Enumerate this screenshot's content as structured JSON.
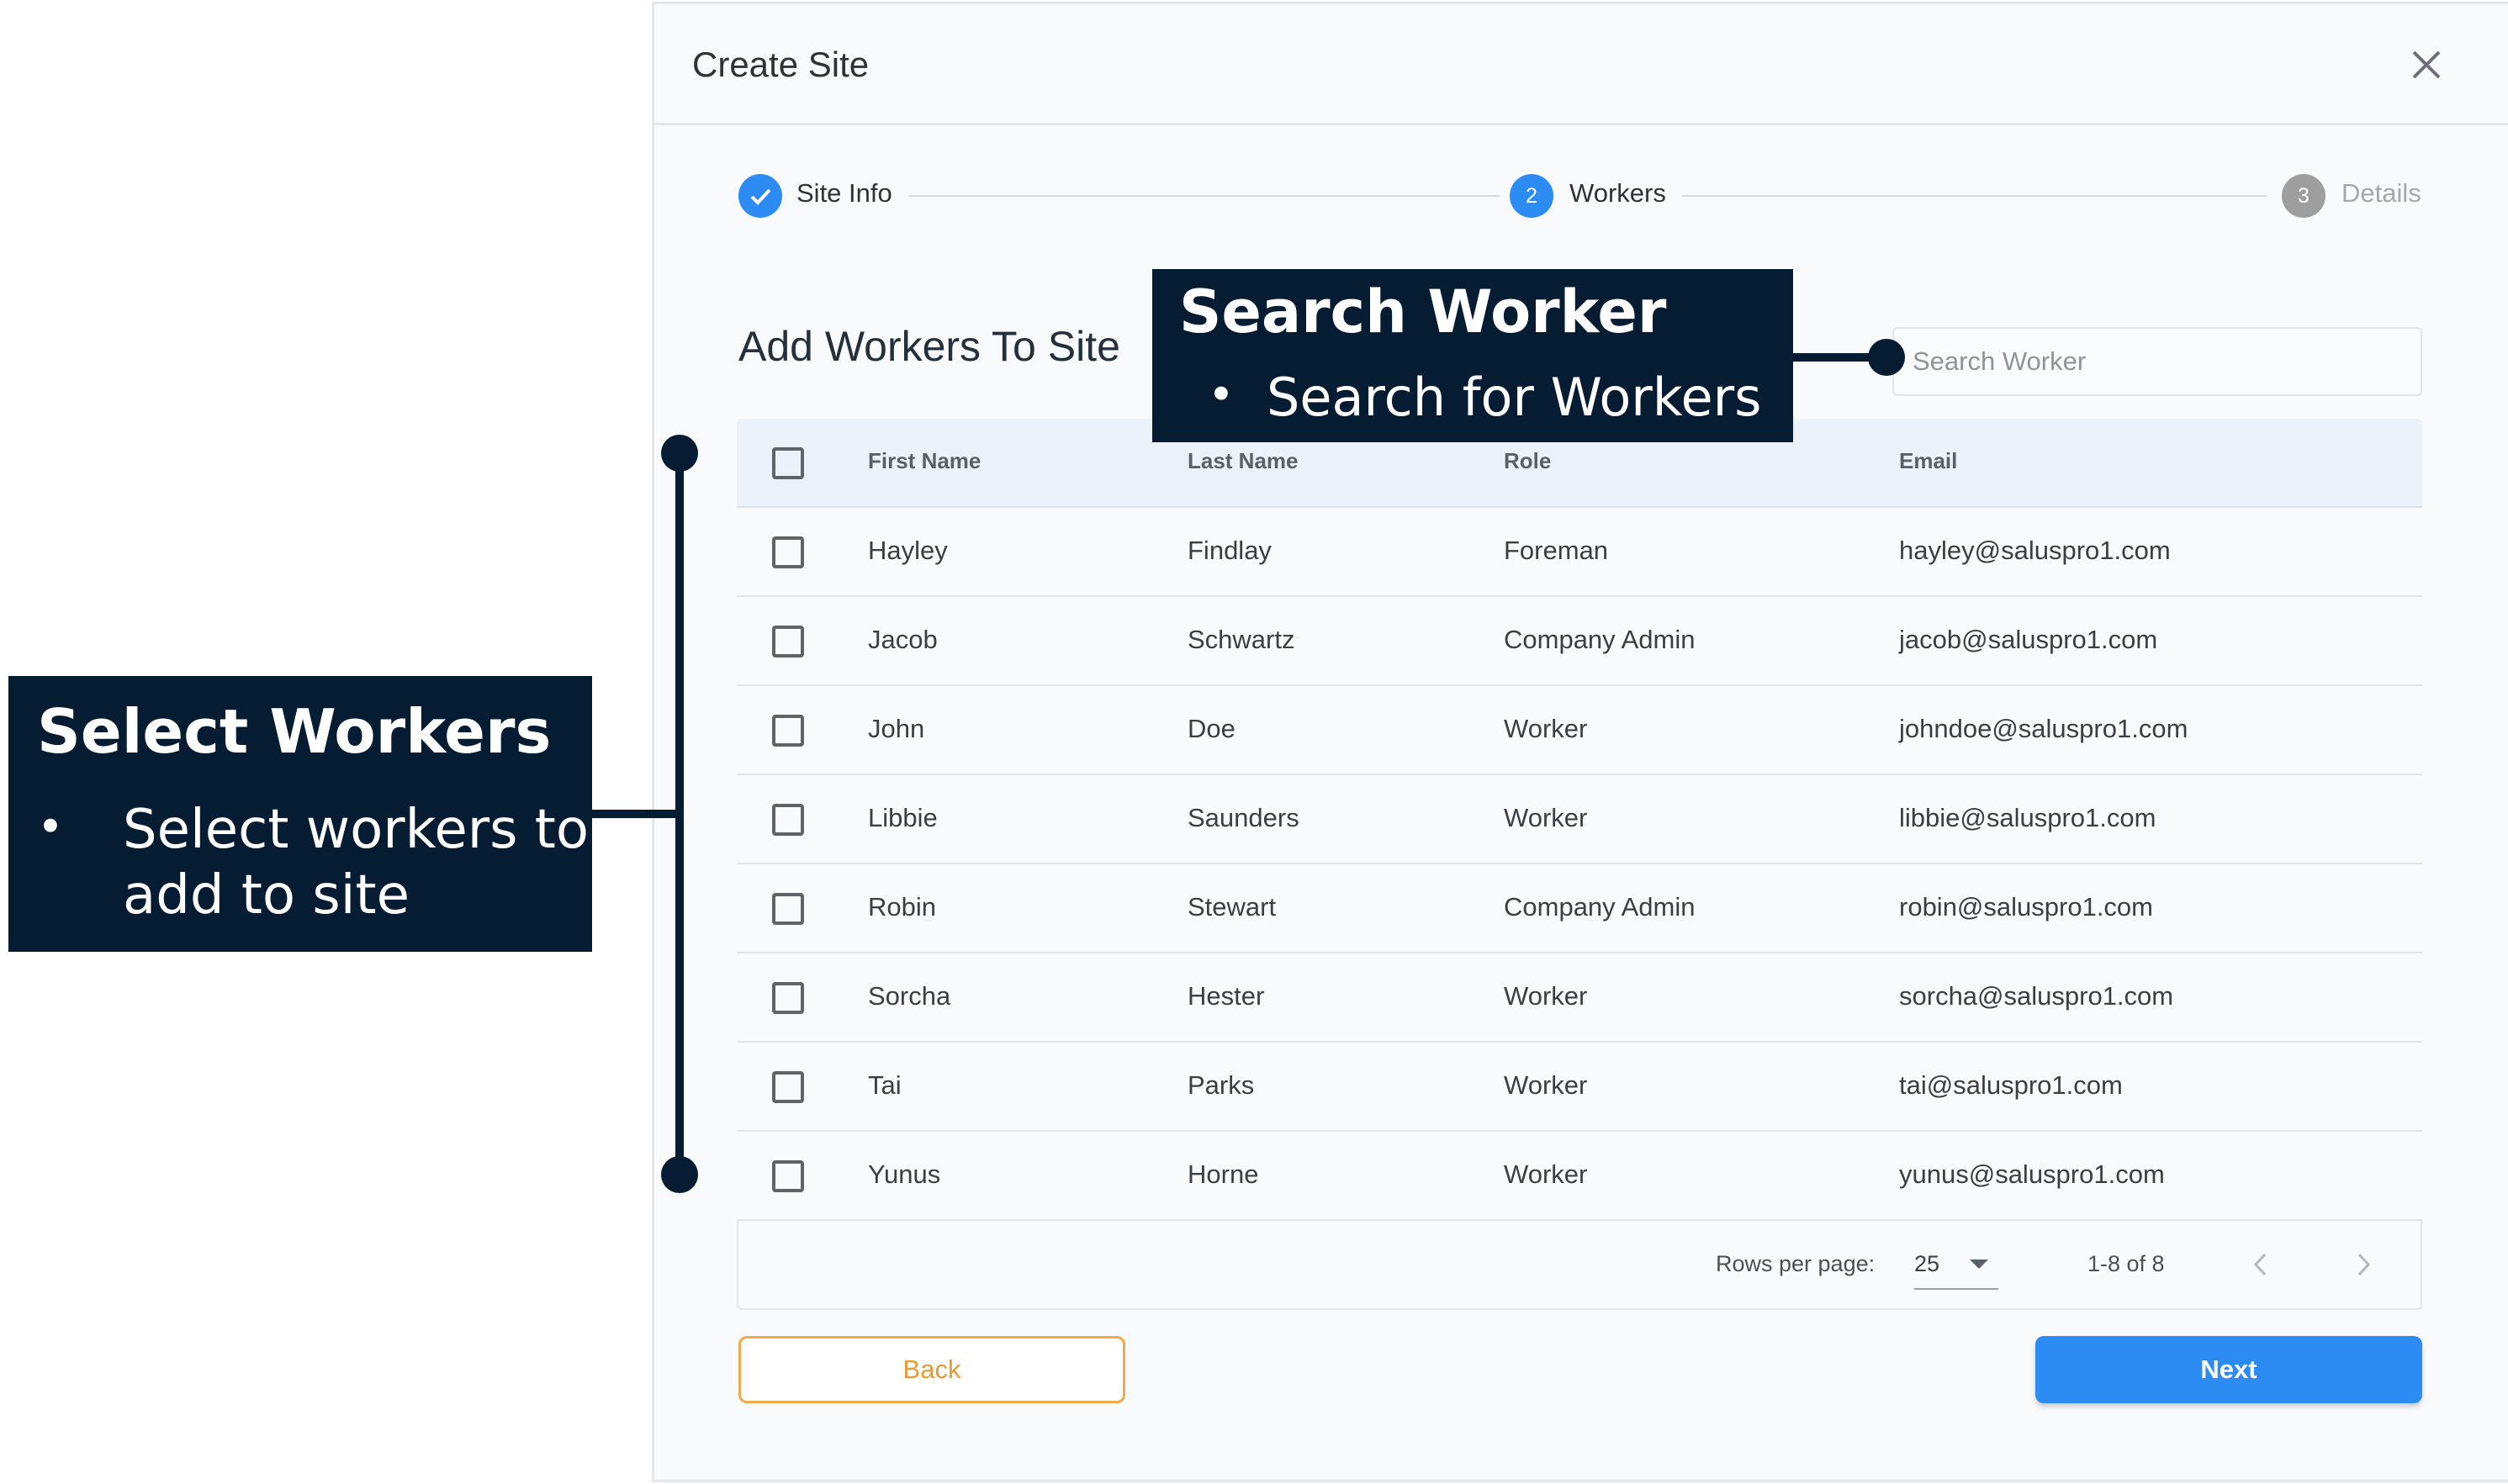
{
  "dialog": {
    "title": "Create Site",
    "close_icon": "close-icon"
  },
  "stepper": {
    "steps": [
      {
        "number": "",
        "label": "Site Info",
        "state": "completed",
        "icon": "check-icon"
      },
      {
        "number": "2",
        "label": "Workers",
        "state": "active"
      },
      {
        "number": "3",
        "label": "Details",
        "state": "upcoming"
      }
    ]
  },
  "section": {
    "title": "Add Workers To Site"
  },
  "search": {
    "placeholder": "Search Worker",
    "value": ""
  },
  "table": {
    "headers": [
      "First Name",
      "Last Name",
      "Role",
      "Email"
    ],
    "rows": [
      {
        "first": "Hayley",
        "last": "Findlay",
        "role": "Foreman",
        "email": "hayley@saluspro1.com"
      },
      {
        "first": "Jacob",
        "last": "Schwartz",
        "role": "Company Admin",
        "email": "jacob@saluspro1.com"
      },
      {
        "first": "John",
        "last": "Doe",
        "role": "Worker",
        "email": "johndoe@saluspro1.com"
      },
      {
        "first": "Libbie",
        "last": "Saunders",
        "role": "Worker",
        "email": "libbie@saluspro1.com"
      },
      {
        "first": "Robin",
        "last": "Stewart",
        "role": "Company Admin",
        "email": "robin@saluspro1.com"
      },
      {
        "first": "Sorcha",
        "last": "Hester",
        "role": "Worker",
        "email": "sorcha@saluspro1.com"
      },
      {
        "first": "Tai",
        "last": "Parks",
        "role": "Worker",
        "email": "tai@saluspro1.com"
      },
      {
        "first": "Yunus",
        "last": "Horne",
        "role": "Worker",
        "email": "yunus@saluspro1.com"
      }
    ]
  },
  "pagination": {
    "rows_per_page_label": "Rows per page:",
    "rows_per_page": "25",
    "range": "1-8 of 8",
    "prev_icon": "chevron-left-icon",
    "next_icon": "chevron-right-icon"
  },
  "actions": {
    "back_label": "Back",
    "next_label": "Next"
  },
  "annotations": {
    "search": {
      "title": "Search Worker",
      "bullet": "Search for Workers"
    },
    "select": {
      "title": "Select Workers",
      "bullet_line1": "Select workers to",
      "bullet_line2": "add to site"
    }
  },
  "colors": {
    "primary": "#2d8cf4",
    "back_accent": "#f0a94c",
    "callout_bg": "#061c33",
    "step_inactive": "#9e9e9e",
    "header_bg": "#ecf2fa"
  }
}
